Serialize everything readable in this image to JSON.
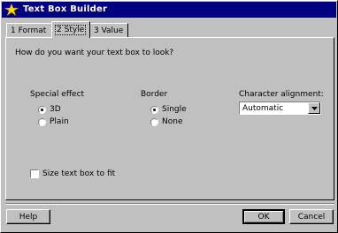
{
  "window": {
    "title": "Text Box Builder"
  },
  "tabs": [
    {
      "label": "1 Format"
    },
    {
      "label": "2 Style"
    },
    {
      "label": "3 Value"
    }
  ],
  "prompt": "How do you want your text box to look?",
  "special_effect": {
    "label": "Special effect",
    "options": [
      {
        "label": "3D",
        "checked": true
      },
      {
        "label": "Plain",
        "checked": false
      }
    ]
  },
  "border": {
    "label": "Border",
    "options": [
      {
        "label": "Single",
        "checked": true
      },
      {
        "label": "None",
        "checked": false
      }
    ]
  },
  "character_alignment": {
    "label": "Character alignment:",
    "value": "Automatic"
  },
  "size_checkbox": {
    "label": "Size text box to fit",
    "checked": false
  },
  "buttons": {
    "help": "Help",
    "ok": "OK",
    "cancel": "Cancel"
  },
  "colors": {
    "title_bar": "#000080",
    "face": "#c0c0c0"
  },
  "icons": {
    "title": "wizard-star-icon",
    "dropdown": "chevron-down-icon"
  }
}
